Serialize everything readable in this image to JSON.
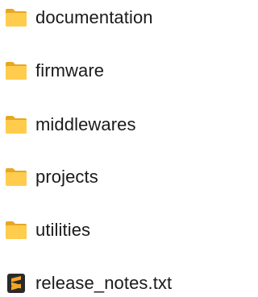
{
  "colors": {
    "folder_back": "#E8A722",
    "folder_front": "#FFCC4D",
    "file_icon_bg": "#2A2A2A",
    "file_icon_mark": "#F5A623",
    "text": "#1a1a1a"
  },
  "file_list": {
    "items": [
      {
        "label": "documentation",
        "type": "folder",
        "icon": "folder-icon"
      },
      {
        "label": "firmware",
        "type": "folder",
        "icon": "folder-icon"
      },
      {
        "label": "middlewares",
        "type": "folder",
        "icon": "folder-icon"
      },
      {
        "label": "projects",
        "type": "folder",
        "icon": "folder-icon"
      },
      {
        "label": "utilities",
        "type": "folder",
        "icon": "folder-icon"
      },
      {
        "label": "release_notes.txt",
        "type": "file",
        "icon": "sublime-text-file-icon"
      }
    ]
  }
}
